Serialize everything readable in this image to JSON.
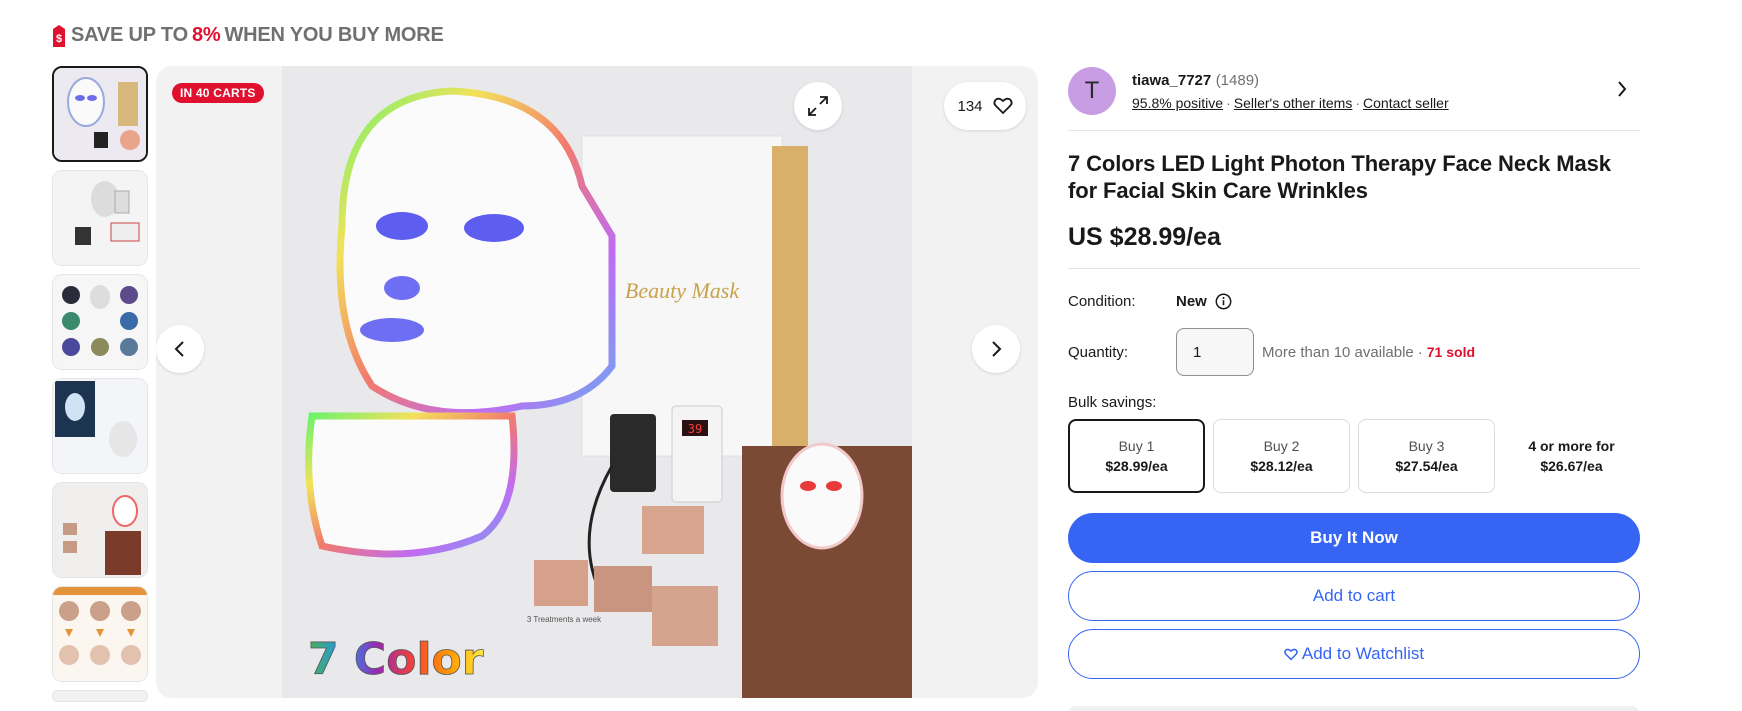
{
  "promo": {
    "prefix": "SAVE UP TO ",
    "percent": "8%",
    "suffix": " WHEN YOU BUY MORE",
    "accent": "#e0102f"
  },
  "gallery": {
    "carts_badge": "IN 40 CARTS",
    "watch_count": "134",
    "thumbnail_count": 7,
    "photo_text": {
      "box": "Beauty Mask",
      "caption": "7 Color",
      "display": "39",
      "treatments": "3 Treatments a week"
    }
  },
  "seller": {
    "initial": "T",
    "name": "tiawa_7727",
    "count": "(1489)",
    "feedback": "95.8% positive",
    "other_items": "Seller's other items",
    "contact": "Contact seller"
  },
  "listing": {
    "title": "7 Colors LED Light Photon Therapy Face Neck Mask for Facial Skin Care Wrinkles",
    "price": "US $28.99/ea",
    "condition_label": "Condition:",
    "condition_value": "New",
    "quantity_label": "Quantity:",
    "quantity_value": "1",
    "availability": "More than 10 available",
    "sold": "71 sold",
    "bulk_label": "Bulk savings:",
    "bulk_options": [
      {
        "qty": "Buy 1",
        "price": "$28.99/ea"
      },
      {
        "qty": "Buy 2",
        "price": "$28.12/ea"
      },
      {
        "qty": "Buy 3",
        "price": "$27.54/ea"
      },
      {
        "qty": "4 or more for",
        "price": "$26.67/ea"
      }
    ]
  },
  "actions": {
    "buy_now": "Buy It Now",
    "add_to_cart": "Add to cart",
    "add_to_watchlist": "Add to Watchlist"
  },
  "colors": {
    "primary": "#3665f3",
    "alert": "#e0102f",
    "avatar": "#c89de3"
  }
}
